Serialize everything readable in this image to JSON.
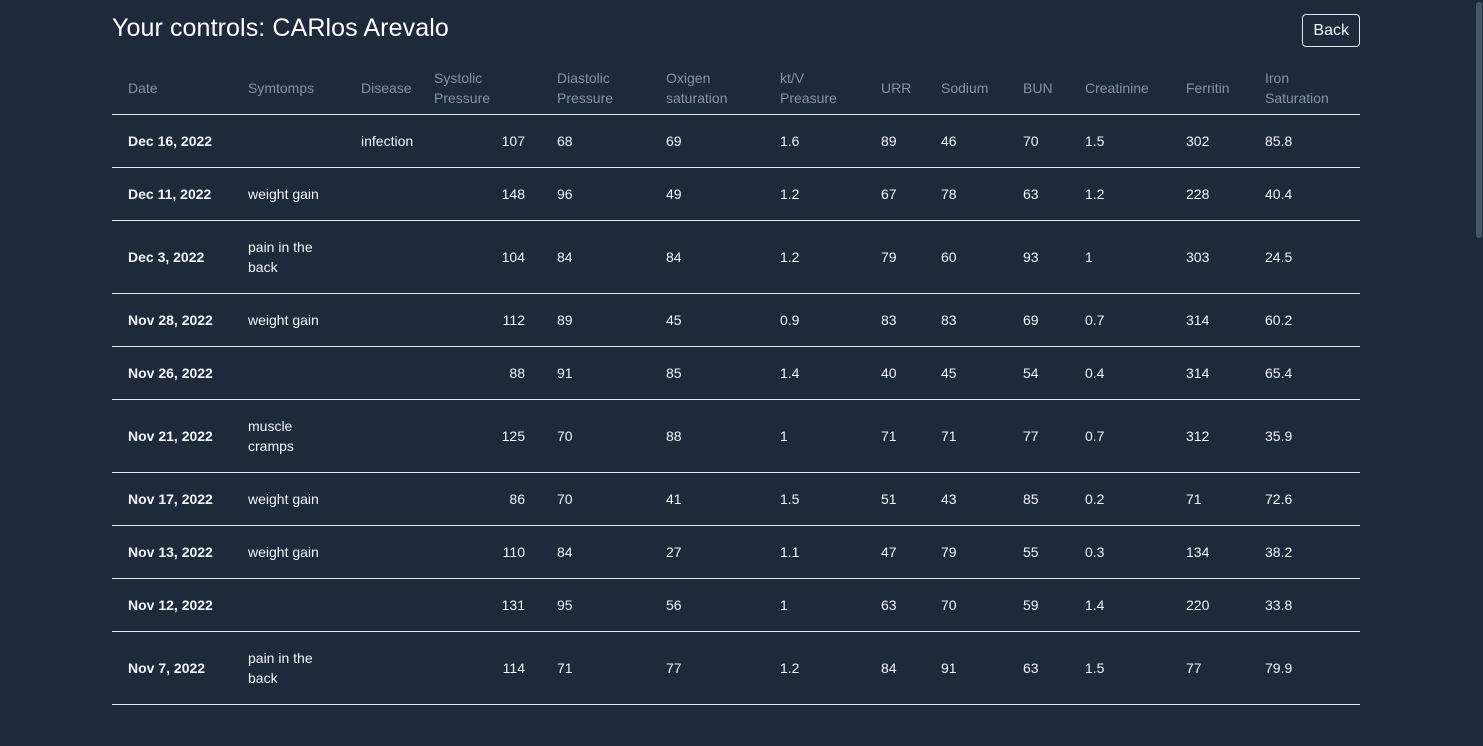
{
  "page": {
    "title": "Your controls: CARlos Arevalo",
    "back_label": "Back"
  },
  "table": {
    "headers": [
      "Date",
      "Symtomps",
      "Disease",
      "Systolic Pressure",
      "Diastolic Pressure",
      "Oxigen saturation",
      "kt/V Preasure",
      "URR",
      "Sodium",
      "BUN",
      "Creatinine",
      "Ferritin",
      "Iron Saturation"
    ],
    "rows": [
      [
        "Dec 16, 2022",
        "",
        "infection",
        "107",
        "68",
        "69",
        "1.6",
        "89",
        "46",
        "70",
        "1.5",
        "302",
        "85.8"
      ],
      [
        "Dec 11, 2022",
        "weight gain",
        "",
        "148",
        "96",
        "49",
        "1.2",
        "67",
        "78",
        "63",
        "1.2",
        "228",
        "40.4"
      ],
      [
        "Dec 3, 2022",
        "pain in the back",
        "",
        "104",
        "84",
        "84",
        "1.2",
        "79",
        "60",
        "93",
        "1",
        "303",
        "24.5"
      ],
      [
        "Nov 28, 2022",
        "weight gain",
        "",
        "112",
        "89",
        "45",
        "0.9",
        "83",
        "83",
        "69",
        "0.7",
        "314",
        "60.2"
      ],
      [
        "Nov 26, 2022",
        "",
        "",
        "88",
        "91",
        "85",
        "1.4",
        "40",
        "45",
        "54",
        "0.4",
        "314",
        "65.4"
      ],
      [
        "Nov 21, 2022",
        "muscle cramps",
        "",
        "125",
        "70",
        "88",
        "1",
        "71",
        "71",
        "77",
        "0.7",
        "312",
        "35.9"
      ],
      [
        "Nov 17, 2022",
        "weight gain",
        "",
        "86",
        "70",
        "41",
        "1.5",
        "51",
        "43",
        "85",
        "0.2",
        "71",
        "72.6"
      ],
      [
        "Nov 13, 2022",
        "weight gain",
        "",
        "110",
        "84",
        "27",
        "1.1",
        "47",
        "79",
        "55",
        "0.3",
        "134",
        "38.2"
      ],
      [
        "Nov 12, 2022",
        "",
        "",
        "131",
        "95",
        "56",
        "1",
        "63",
        "70",
        "59",
        "1.4",
        "220",
        "33.8"
      ],
      [
        "Nov 7, 2022",
        "pain in the back",
        "",
        "114",
        "71",
        "77",
        "1.2",
        "84",
        "91",
        "63",
        "1.5",
        "77",
        "79.9"
      ]
    ]
  }
}
